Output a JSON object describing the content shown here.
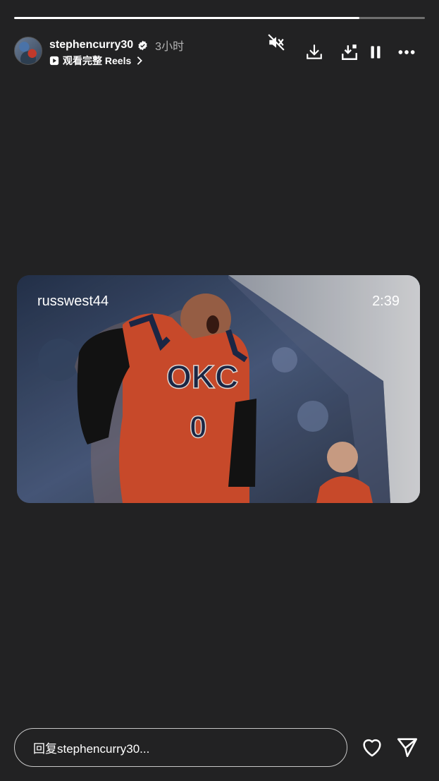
{
  "progress": {
    "fraction": 0.84
  },
  "header": {
    "username": "stephencurry30",
    "time": "3小时",
    "reels_link": "观看完整 Reels"
  },
  "card": {
    "username": "russwest44",
    "duration": "2:39",
    "jersey_team": "OKC",
    "jersey_number": "0"
  },
  "reply": {
    "placeholder": "回复stephencurry30..."
  },
  "icons": {
    "mute": "speaker-muted-icon",
    "download": "download-icon",
    "save": "save-icon",
    "pause": "pause-icon",
    "more": "more-icon",
    "like": "heart-icon",
    "share": "send-icon"
  },
  "colors": {
    "background": "#222223",
    "jersey": "#d8502e"
  }
}
